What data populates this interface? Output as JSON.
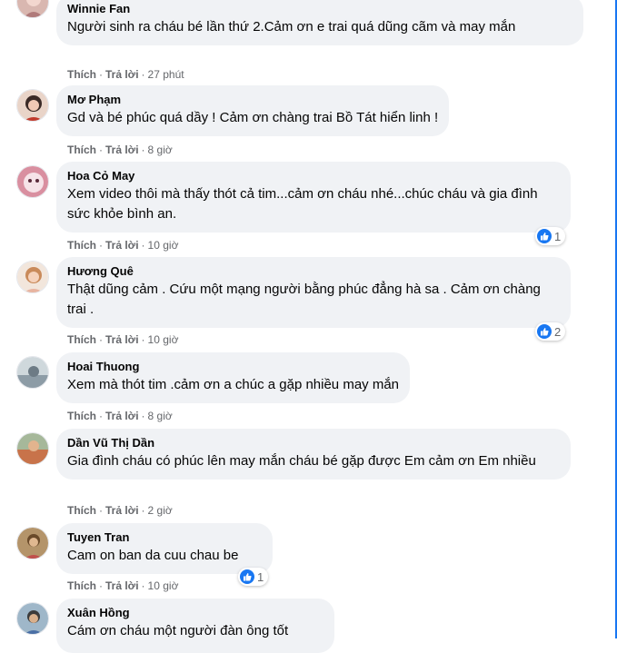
{
  "ui": {
    "like_label": "Thích",
    "reply_label": "Trả lời",
    "separator": "·"
  },
  "comments": [
    {
      "author": "Winnie Fan",
      "text": "Người sinh ra cháu bé lần thứ 2.Cảm ơn e trai quá dũng cãm và may mắn",
      "time": "27 phút"
    },
    {
      "author": "Mơ Phạm",
      "text": "Gd và bé phúc quá dầy ! Cảm ơn chàng trai Bồ Tát hiển linh !",
      "time": "8 giờ"
    },
    {
      "author": "Hoa Cỏ May",
      "text": "Xem video thôi mà thấy thót cả tim...cảm ơn cháu nhé...chúc cháu và gia đình sức khỏe bình an.",
      "time": "10 giờ",
      "reactions": "1"
    },
    {
      "author": "Hương Quê",
      "text": "Thật dũng cảm . Cứu một mạng người bằng phúc đẳng hà sa . Cảm ơn chàng trai .",
      "time": "10 giờ",
      "reactions": "2"
    },
    {
      "author": "Hoai Thuong",
      "text": "Xem mà thót tim .cảm ơn a chúc a gặp nhiều may mắn",
      "time": "8 giờ"
    },
    {
      "author": "Dần Vũ Thị Dần",
      "text": "Gia đình cháu có phúc lên may mắn cháu bé gặp được Em cảm ơn Em nhiều",
      "time": "2 giờ"
    },
    {
      "author": "Tuyen Tran",
      "text": "Cam on ban da cuu chau be",
      "time": "10 giờ",
      "reactions": "1"
    },
    {
      "author": "Xuân Hồng",
      "text": "Cám ơn cháu một người đàn ông tốt"
    }
  ],
  "colors": {
    "bubble": "#f0f2f5",
    "meta": "#65676b",
    "accent": "#1877f2"
  },
  "icons": {
    "reaction": "thumbs-up-icon"
  }
}
